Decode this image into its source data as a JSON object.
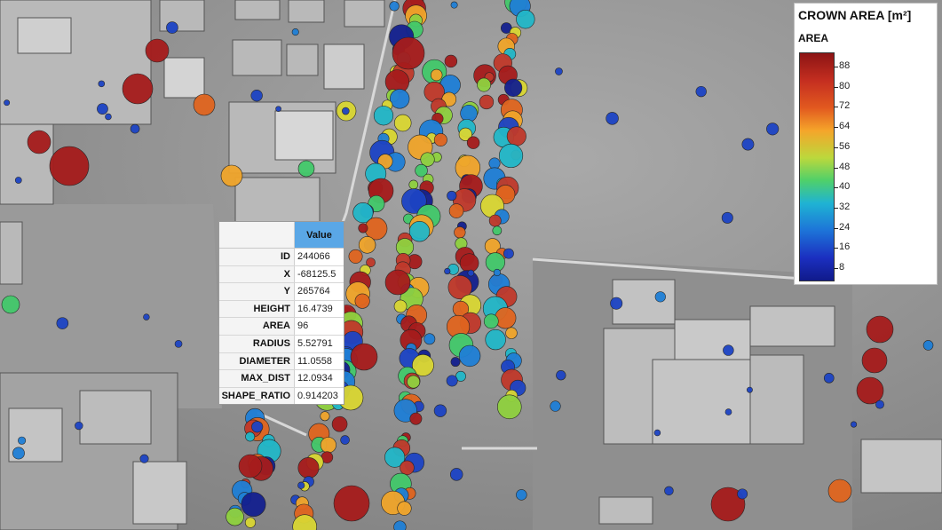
{
  "legend": {
    "title": "CROWN AREA [m²]",
    "subtitle": "AREA",
    "ticks": [
      "88",
      "80",
      "72",
      "64",
      "56",
      "48",
      "40",
      "32",
      "24",
      "16",
      "8"
    ]
  },
  "table": {
    "header": "Value",
    "rows": [
      {
        "key": "ID",
        "value": "244066"
      },
      {
        "key": "X",
        "value": "-68125.5"
      },
      {
        "key": "Y",
        "value": "265764"
      },
      {
        "key": "HEIGHT",
        "value": "16.4739"
      },
      {
        "key": "AREA",
        "value": "96"
      },
      {
        "key": "RADIUS",
        "value": "5.52791"
      },
      {
        "key": "DIAMETER",
        "value": "11.0558"
      },
      {
        "key": "MAX_DIST",
        "value": "12.0934"
      },
      {
        "key": "SHAPE_RATIO",
        "value": "0.914203"
      }
    ]
  }
}
